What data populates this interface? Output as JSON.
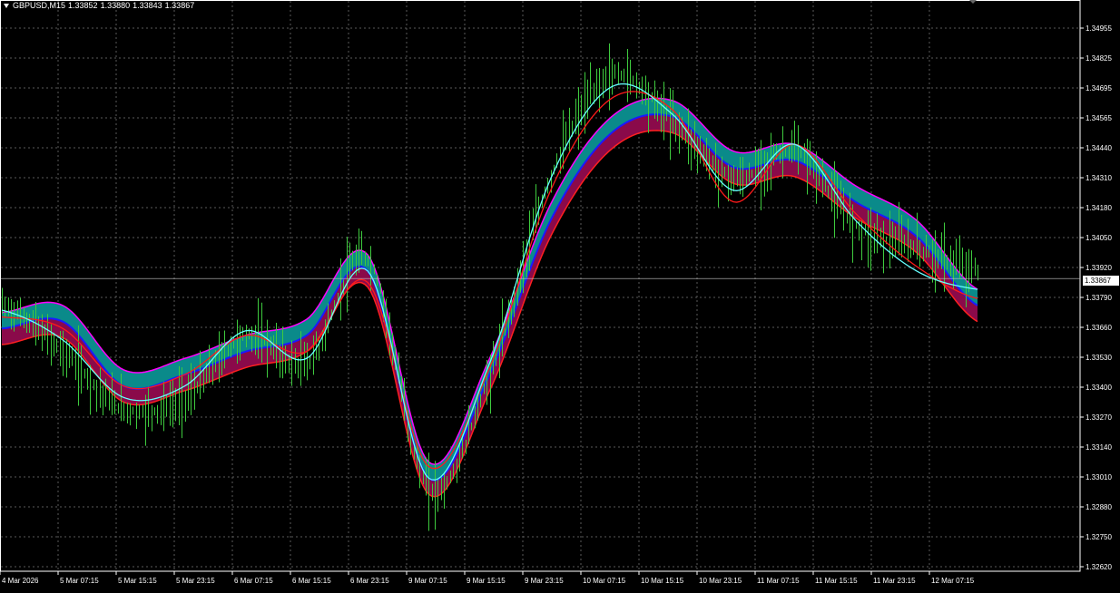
{
  "header": {
    "symbol": "GBPUSD,M15",
    "open": "1.33852",
    "high": "1.33880",
    "low": "1.33843",
    "close": "1.33867",
    "menu_icon": "triangle-down-icon"
  },
  "current_price_label": "1.33867",
  "colors": {
    "background": "#000000",
    "grid": "#5a5a5a",
    "price_bars": "#3ecb3e",
    "fast_line": "#66ffff",
    "slow_line": "#ff1a1a",
    "band_upper_fill": "#0a8a8a",
    "band_lower_fill": "#8a0a4a",
    "band_mid_line": "#1a1aff",
    "band_edge": "#ff00ff",
    "axis_text": "#ffffff"
  },
  "chart_data": {
    "type": "line",
    "title": "GBPUSD,M15",
    "y_ticks": [
      "1.34955",
      "1.34825",
      "1.34695",
      "1.34565",
      "1.34440",
      "1.34310",
      "1.34180",
      "1.34050",
      "1.33920",
      "1.33790",
      "1.33660",
      "1.33530",
      "1.33400",
      "1.33270",
      "1.33140",
      "1.33010",
      "1.32880",
      "1.32750",
      "1.32620"
    ],
    "x_ticks": [
      "4 Mar 2026",
      "5 Mar 07:15",
      "5 Mar 15:15",
      "5 Mar 23:15",
      "6 Mar 07:15",
      "6 Mar 15:15",
      "6 Mar 23:15",
      "9 Mar 07:15",
      "9 Mar 15:15",
      "9 Mar 23:15",
      "10 Mar 07:15",
      "10 Mar 15:15",
      "10 Mar 23:15",
      "11 Mar 07:15",
      "11 Mar 15:15",
      "11 Mar 23:15",
      "12 Mar 07:15"
    ],
    "ylim": [
      1.3262,
      1.3502
    ],
    "grid": true,
    "current_price": 1.33867,
    "series": [
      {
        "name": "price",
        "x": [
          0,
          1,
          2,
          3,
          4,
          5,
          6,
          7,
          8,
          9,
          10,
          11,
          12,
          13,
          14,
          15,
          16
        ],
        "values": [
          1.3375,
          1.3355,
          1.333,
          1.3335,
          1.3362,
          1.335,
          1.3395,
          1.3295,
          1.3345,
          1.3431,
          1.3475,
          1.3455,
          1.343,
          1.3442,
          1.341,
          1.34,
          1.339
        ]
      },
      {
        "name": "fast",
        "x": [
          0,
          1,
          2,
          3,
          4,
          5,
          6,
          7,
          8,
          9,
          10,
          11,
          12,
          13,
          14,
          15,
          16
        ],
        "values": [
          1.3373,
          1.336,
          1.3335,
          1.334,
          1.3364,
          1.3352,
          1.339,
          1.33,
          1.335,
          1.343,
          1.347,
          1.3458,
          1.3425,
          1.3445,
          1.3412,
          1.339,
          1.3382
        ]
      },
      {
        "name": "slow",
        "x": [
          0,
          1,
          2,
          3,
          4,
          5,
          6,
          7,
          8,
          9,
          10,
          11,
          12,
          13,
          14,
          15,
          16
        ],
        "values": [
          1.337,
          1.3365,
          1.334,
          1.3345,
          1.3362,
          1.3355,
          1.3385,
          1.3305,
          1.3348,
          1.3425,
          1.3465,
          1.346,
          1.342,
          1.3445,
          1.3415,
          1.3392,
          1.3378
        ]
      },
      {
        "name": "band_mid",
        "x": [
          0,
          1,
          2,
          3,
          4,
          5,
          6,
          7,
          8,
          9,
          10,
          11,
          12,
          13,
          14,
          15,
          16
        ],
        "values": [
          1.3365,
          1.3368,
          1.334,
          1.3345,
          1.3355,
          1.3362,
          1.339,
          1.33,
          1.3345,
          1.3412,
          1.345,
          1.3457,
          1.3435,
          1.3438,
          1.342,
          1.3405,
          1.3375
        ]
      }
    ]
  }
}
